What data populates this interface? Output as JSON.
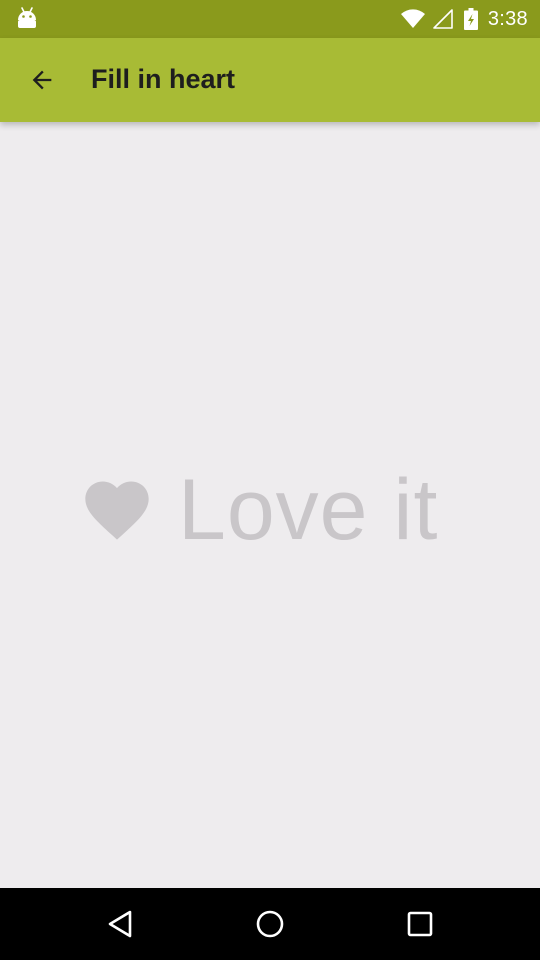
{
  "status_bar": {
    "time": "3:38",
    "icons": [
      "android-icon",
      "wifi-icon",
      "signal-icon",
      "battery-icon"
    ]
  },
  "app_bar": {
    "title": "Fill in heart",
    "back_icon": "arrow-back-icon",
    "color": "#a8bb35"
  },
  "content": {
    "love_label": "Love it",
    "heart_icon": "heart-icon",
    "heart_filled": false,
    "muted_color": "#c9c6c9"
  },
  "nav_bar": {
    "buttons": [
      "back-triangle-icon",
      "home-circle-icon",
      "recents-square-icon"
    ]
  },
  "colors": {
    "status_bar": "#8a9a1c",
    "background": "#eeecee"
  }
}
